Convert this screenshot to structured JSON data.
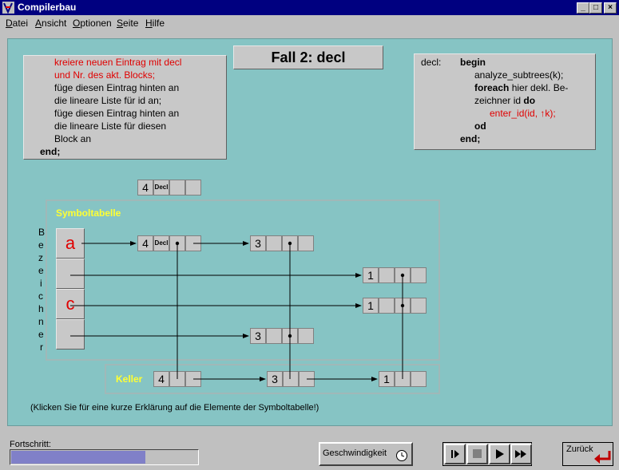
{
  "window": {
    "title": "Compilerbau"
  },
  "menu": [
    "Datei",
    "Ansicht",
    "Optionen",
    "Seite",
    "Hilfe"
  ],
  "case_title": "Fall 2: decl",
  "left_code": [
    {
      "text": "kreiere neuen Eintrag mit decl",
      "red": true
    },
    {
      "text": "und Nr. des akt. Blocks;",
      "red": true
    },
    {
      "text": "füge diesen Eintrag hinten an",
      "red": false
    },
    {
      "text": "die lineare Liste für id an;",
      "red": false
    },
    {
      "text": "füge diesen Eintrag hinten an",
      "red": false
    },
    {
      "text": "die lineare Liste für diesen",
      "red": false
    },
    {
      "text": "Block an",
      "red": false
    },
    {
      "text": "end;",
      "red": false
    }
  ],
  "right_code": {
    "label": "decl:",
    "begin": "begin",
    "line1": "analyze_subtrees(k);",
    "foreach": "foreach",
    "line2": " hier dekl. Be-",
    "line3": "zeichner id ",
    "do": "do",
    "line4": "enter_id(id, ↑k);",
    "od": "od",
    "end": "end;"
  },
  "new_entry": {
    "num": "4",
    "tag": "Decl"
  },
  "symboltabelle_label": "Symboltabelle",
  "bezeichner_letters": [
    "B",
    "e",
    "z",
    "e",
    "i",
    "c",
    "h",
    "n",
    "e",
    "r"
  ],
  "names": [
    "a",
    "",
    "c",
    ""
  ],
  "entries": {
    "a1": "4",
    "a1_tag": "Decl",
    "a2": "3",
    "b1": "1",
    "c1": "1",
    "d1": "3"
  },
  "keller": {
    "label": "Keller",
    "k1": "4",
    "k2": "3",
    "k3": "1"
  },
  "hint": "(Klicken Sie für eine kurze Erklärung auf die Elemente der Symboltabelle!)",
  "progress": {
    "label": "Fortschritt:",
    "value": 0.72
  },
  "speed_button": "Geschwindigkeit",
  "back_button": "Zurück",
  "colors": {
    "accent_red": "#e00000",
    "canvas": "#86c4c4",
    "yellow": "#ffff33",
    "progress": "#8080c8"
  }
}
